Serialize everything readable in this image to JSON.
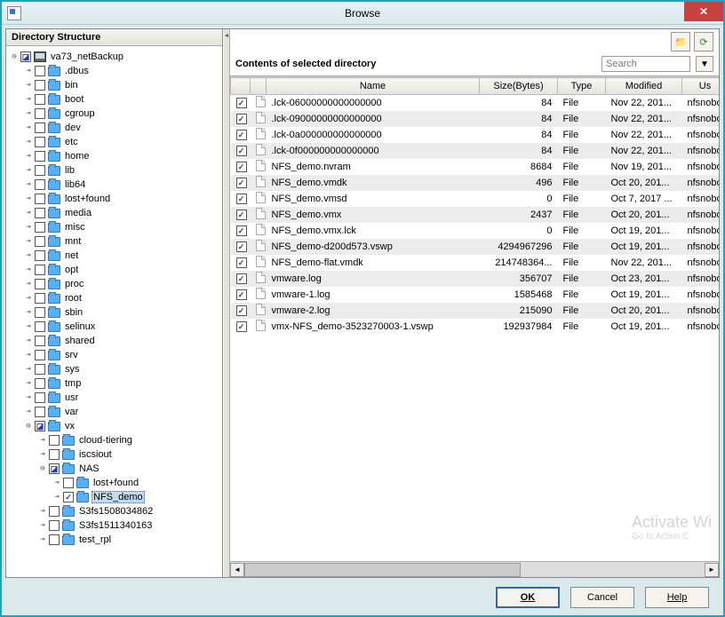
{
  "window": {
    "title": "Browse"
  },
  "leftPane": {
    "header": "Directory Structure"
  },
  "tree": {
    "root": {
      "label": "va73_netBackup",
      "checked": true,
      "partial": true
    },
    "level1": [
      {
        "label": ".dbus",
        "checked": false
      },
      {
        "label": "bin",
        "checked": false
      },
      {
        "label": "boot",
        "checked": false
      },
      {
        "label": "cgroup",
        "checked": false
      },
      {
        "label": "dev",
        "checked": false
      },
      {
        "label": "etc",
        "checked": false
      },
      {
        "label": "home",
        "checked": false
      },
      {
        "label": "lib",
        "checked": false
      },
      {
        "label": "lib64",
        "checked": false
      },
      {
        "label": "lost+found",
        "checked": false
      },
      {
        "label": "media",
        "checked": false
      },
      {
        "label": "misc",
        "checked": false
      },
      {
        "label": "mnt",
        "checked": false
      },
      {
        "label": "net",
        "checked": false
      },
      {
        "label": "opt",
        "checked": false
      },
      {
        "label": "proc",
        "checked": false
      },
      {
        "label": "root",
        "checked": false
      },
      {
        "label": "sbin",
        "checked": false
      },
      {
        "label": "selinux",
        "checked": false
      },
      {
        "label": "shared",
        "checked": false
      },
      {
        "label": "srv",
        "checked": false
      },
      {
        "label": "sys",
        "checked": false
      },
      {
        "label": "tmp",
        "checked": false
      },
      {
        "label": "usr",
        "checked": false
      },
      {
        "label": "var",
        "checked": false
      }
    ],
    "vx": {
      "label": "vx",
      "checked": true,
      "partial": true
    },
    "vx_children": [
      {
        "label": "cloud-tiering",
        "checked": false
      },
      {
        "label": "iscsiout",
        "checked": false
      }
    ],
    "nas": {
      "label": "NAS",
      "checked": true,
      "partial": true
    },
    "nas_children": [
      {
        "label": "lost+found",
        "checked": false
      },
      {
        "label": "NFS_demo",
        "checked": true,
        "selected": true
      }
    ],
    "vx_tail": [
      {
        "label": "S3fs1508034862",
        "checked": false
      },
      {
        "label": "S3fs1511340163",
        "checked": false
      },
      {
        "label": "test_rpl",
        "checked": false
      }
    ]
  },
  "rightPane": {
    "contentsLabel": "Contents of selected directory",
    "searchPlaceholder": "Search",
    "columns": {
      "name": "Name",
      "size": "Size(Bytes)",
      "type": "Type",
      "modified": "Modified",
      "user": "Us"
    }
  },
  "files": [
    {
      "name": ".lck-06000000000000000",
      "size": "84",
      "type": "File",
      "modified": "Nov 22, 201...",
      "user": "nfsnobo"
    },
    {
      "name": ".lck-09000000000000000",
      "size": "84",
      "type": "File",
      "modified": "Nov 22, 201...",
      "user": "nfsnobo"
    },
    {
      "name": ".lck-0a000000000000000",
      "size": "84",
      "type": "File",
      "modified": "Nov 22, 201...",
      "user": "nfsnobo"
    },
    {
      "name": ".lck-0f000000000000000",
      "size": "84",
      "type": "File",
      "modified": "Nov 22, 201...",
      "user": "nfsnobo"
    },
    {
      "name": "NFS_demo.nvram",
      "size": "8684",
      "type": "File",
      "modified": "Nov 19, 201...",
      "user": "nfsnobo"
    },
    {
      "name": "NFS_demo.vmdk",
      "size": "496",
      "type": "File",
      "modified": "Oct 20, 201...",
      "user": "nfsnobo"
    },
    {
      "name": "NFS_demo.vmsd",
      "size": "0",
      "type": "File",
      "modified": "Oct 7, 2017 ...",
      "user": "nfsnobo"
    },
    {
      "name": "NFS_demo.vmx",
      "size": "2437",
      "type": "File",
      "modified": "Oct 20, 201...",
      "user": "nfsnobo"
    },
    {
      "name": "NFS_demo.vmx.lck",
      "size": "0",
      "type": "File",
      "modified": "Oct 19, 201...",
      "user": "nfsnobo"
    },
    {
      "name": "NFS_demo-d200d573.vswp",
      "size": "4294967296",
      "type": "File",
      "modified": "Oct 19, 201...",
      "user": "nfsnobo"
    },
    {
      "name": "NFS_demo-flat.vmdk",
      "size": "214748364...",
      "type": "File",
      "modified": "Nov 22, 201...",
      "user": "nfsnobo"
    },
    {
      "name": "vmware.log",
      "size": "356707",
      "type": "File",
      "modified": "Oct 23, 201...",
      "user": "nfsnobo"
    },
    {
      "name": "vmware-1.log",
      "size": "1585468",
      "type": "File",
      "modified": "Oct 19, 201...",
      "user": "nfsnobo"
    },
    {
      "name": "vmware-2.log",
      "size": "215090",
      "type": "File",
      "modified": "Oct 20, 201...",
      "user": "nfsnobo"
    },
    {
      "name": "vmx-NFS_demo-3523270003-1.vswp",
      "size": "192937984",
      "type": "File",
      "modified": "Oct 19, 201...",
      "user": "nfsnobo"
    }
  ],
  "buttons": {
    "ok": "OK",
    "cancel": "Cancel",
    "help": "Help"
  },
  "watermark": {
    "line1": "Activate Wi",
    "line2": "Go to Action C"
  }
}
